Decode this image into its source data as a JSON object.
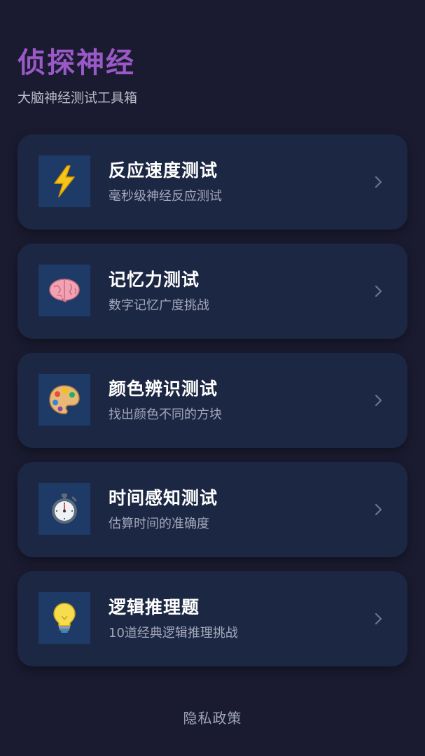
{
  "header": {
    "title": "侦探神经",
    "subtitle": "大脑神经测试工具箱"
  },
  "colors": {
    "background": "#1a1b30",
    "card": "#1c2743",
    "icon_box": "#1e3a66",
    "title_accent": "#9b59c8",
    "muted_text": "#a3a8bb"
  },
  "cards": [
    {
      "title": "反应速度测试",
      "desc": "毫秒级神经反应测试",
      "icon": "lightning-icon"
    },
    {
      "title": "记忆力测试",
      "desc": "数字记忆广度挑战",
      "icon": "brain-icon"
    },
    {
      "title": "颜色辨识测试",
      "desc": "找出颜色不同的方块",
      "icon": "palette-icon"
    },
    {
      "title": "时间感知测试",
      "desc": "估算时间的准确度",
      "icon": "stopwatch-icon"
    },
    {
      "title": "逻辑推理题",
      "desc": "10道经典逻辑推理挑战",
      "icon": "lightbulb-icon"
    }
  ],
  "footer": {
    "privacy_label": "隐私政策"
  }
}
